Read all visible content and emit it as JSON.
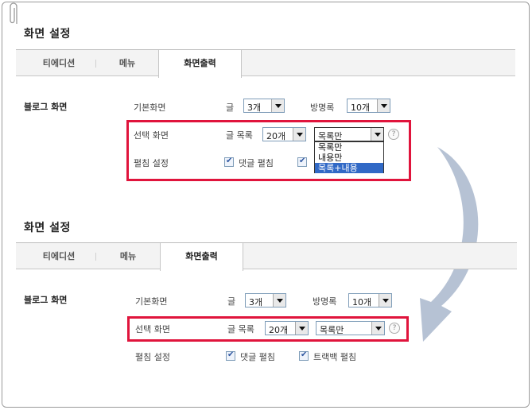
{
  "top": {
    "title": "화면 설정",
    "tabs": [
      "티에디션",
      "메뉴",
      "화면출력"
    ],
    "section_label": "블로그 화면",
    "rows": {
      "basic": {
        "label": "기본화면",
        "post_label": "글",
        "post_value": "3개",
        "guestbook_label": "방명록",
        "guestbook_value": "10개"
      },
      "select": {
        "label": "선택 화면",
        "list_label": "글 목록",
        "list_value": "20개",
        "mode_value": "목록만",
        "help": "?"
      },
      "expand": {
        "label": "펼침 설정",
        "comment_label": "댓글 펼침"
      }
    },
    "dropdown_options": [
      "목록만",
      "내용만",
      "목록+내용"
    ]
  },
  "bottom": {
    "title": "화면 설정",
    "tabs": [
      "티에디션",
      "메뉴",
      "화면출력"
    ],
    "section_label": "블로그 화면",
    "rows": {
      "basic": {
        "label": "기본화면",
        "post_label": "글",
        "post_value": "3개",
        "guestbook_label": "방명록",
        "guestbook_value": "10개"
      },
      "select": {
        "label": "선택 화면",
        "list_label": "글 목록",
        "list_value": "20개",
        "mode_value": "목록만",
        "help": "?"
      },
      "expand": {
        "label": "펼침 설정",
        "comment_label": "댓글 펼침",
        "trackback_label": "트랙백 펼침"
      }
    }
  },
  "colors": {
    "highlight": "#e0143c",
    "arrow": "#a9b7cc",
    "selected_option": "#3169c6"
  }
}
